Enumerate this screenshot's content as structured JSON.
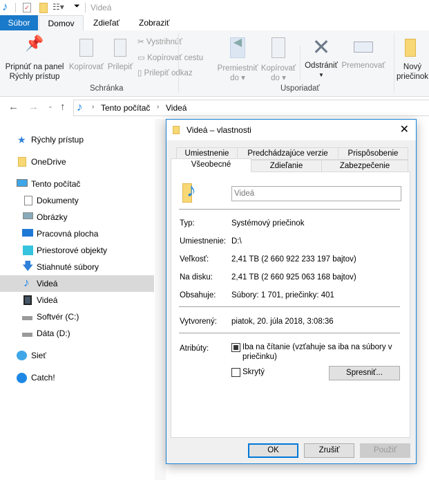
{
  "window": {
    "title": "Videá"
  },
  "ribbon_tabs": [
    "Súbor",
    "Domov",
    "Zdieľať",
    "Zobraziť"
  ],
  "ribbon": {
    "pin": [
      "Pripnúť na panel",
      "Rýchly prístup"
    ],
    "copy": "Kopírovať",
    "paste": "Prilepiť",
    "cut": "Vystrihnúť",
    "copy_path": "Kopírovať cestu",
    "paste_shortcut": "Prilepiť odkaz",
    "group_clipboard": "Schránka",
    "move_to": [
      "Premiestniť",
      "do"
    ],
    "copy_to": [
      "Kopírovať",
      "do"
    ],
    "delete": "Odstrániť",
    "rename": "Premenovať",
    "group_organize": "Usporiadať",
    "new_folder": [
      "Nový",
      "priečinok"
    ]
  },
  "address": {
    "segments": [
      "Tento počítač",
      "Videá"
    ]
  },
  "nav": {
    "quick_access": "Rýchly prístup",
    "onedrive": "OneDrive",
    "this_pc": "Tento počítač",
    "pc_items": [
      "Dokumenty",
      "Obrázky",
      "Pracovná plocha",
      "Priestorové objekty",
      "Stiahnuté súbory",
      "Videá",
      "Videá",
      "Softvér (C:)",
      "Dáta (D:)"
    ],
    "network": "Sieť",
    "catch": "Catch!"
  },
  "dialog": {
    "title": "Videá – vlastnosti",
    "tabs_row1": [
      "Umiestnenie",
      "Predchádzajúce verzie",
      "Prispôsobenie"
    ],
    "tabs_row2": [
      "Všeobecné",
      "Zdieľanie",
      "Zabezpečenie"
    ],
    "name": "Videá",
    "rows": [
      {
        "label": "Typ:",
        "value": "Systémový priečinok"
      },
      {
        "label": "Umiestnenie:",
        "value": "D:\\"
      },
      {
        "label": "Veľkosť:",
        "value": "2,41 TB (2 660 922 233 197 bajtov)"
      },
      {
        "label": "Na disku:",
        "value": "2,41 TB (2 660 925 063 168 bajtov)"
      },
      {
        "label": "Obsahuje:",
        "value": "Súbory: 1 701, priečinky: 401"
      }
    ],
    "created": {
      "label": "Vytvorený:",
      "value": "piatok, 20. júla 2018, 3:08:36"
    },
    "attributes_label": "Atribúty:",
    "readonly": "Iba na čítanie (vzťahuje sa iba na súbory v priečinku)",
    "hidden": "Skrytý",
    "advanced": "Spresniť...",
    "ok": "OK",
    "cancel": "Zrušiť",
    "apply": "Použiť"
  }
}
